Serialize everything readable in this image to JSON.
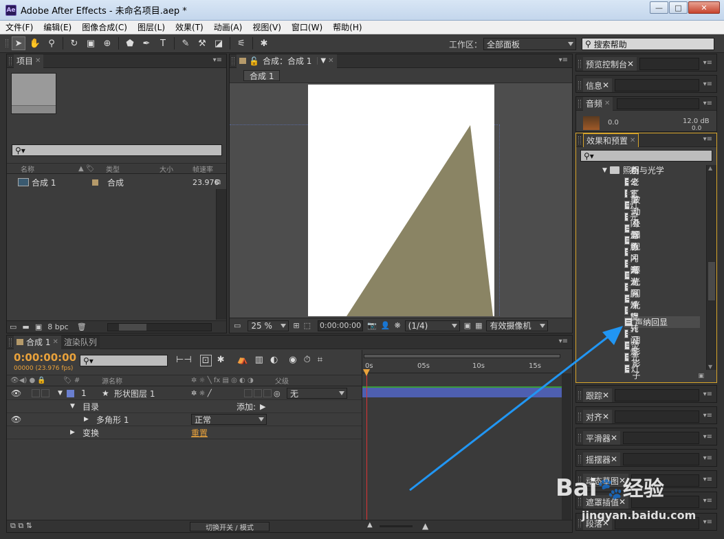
{
  "window": {
    "title": "Adobe After Effects - 未命名项目.aep *",
    "logo": "Ae",
    "buttons": [
      "—",
      "□",
      "✕"
    ]
  },
  "menu": [
    "文件(F)",
    "编辑(E)",
    "图像合成(C)",
    "图层(L)",
    "效果(T)",
    "动画(A)",
    "视图(V)",
    "窗口(W)",
    "帮助(H)"
  ],
  "toolbar": {
    "workspace_label": "工作区：",
    "workspace_value": "全部面板",
    "search_placeholder": "搜索帮助",
    "tools": [
      "selection-tool-icon",
      "hand-tool-icon",
      "zoom-tool-icon",
      "rotate-tool-icon",
      "camera-orbit-icon",
      "pan-behind-icon",
      "shape-tool-icon",
      "pen-tool-icon",
      "text-tool-icon",
      "brush-tool-icon",
      "clone-stamp-icon",
      "eraser-icon",
      "roto-brush-icon",
      "puppet-pin-icon"
    ]
  },
  "project": {
    "tab": "项目",
    "columns": [
      "名称",
      "类型",
      "大小",
      "帧速率"
    ],
    "items": [
      {
        "name": "合成 1",
        "type": "合成",
        "fps": "23.976"
      }
    ],
    "bpc": "8 bpc"
  },
  "comp": {
    "tab": "合成：合成 1",
    "breadcrumb": "合成 1",
    "zoom": "25 %",
    "timecode": "0:00:00:00",
    "resolution": "(1/4)",
    "camera": "有效摄像机",
    "shape_color": "#8a8464"
  },
  "timeline": {
    "tab": "合成 1",
    "render_tab": "渲染队列",
    "timecode": "0:00:00:00",
    "fps_info": "00000 (23.976 fps)",
    "columns": {
      "source": "源名称",
      "parent": "父级"
    },
    "layer": {
      "index": "1",
      "name": "形状图层 1",
      "parent": "无"
    },
    "rows": {
      "contents": "目录",
      "add": "添加:",
      "polygon": "多角形 1",
      "mode": "正常",
      "transform": "变换",
      "reset": "重置"
    },
    "ruler": [
      "0s",
      "05s",
      "10s",
      "15s"
    ],
    "bottom_button": "切换开关 / 模式"
  },
  "right": {
    "preview": "预览控制台",
    "info": "信息",
    "audio": "音频",
    "audio_levels": {
      "left": "0.0",
      "right": "12.0 dB",
      "right2": "0.0"
    },
    "effects": {
      "tab": "效果和预置",
      "folder": "照明与光学",
      "items": [
        "百老汇",
        "办公室灯光",
        "波动",
        "单词闪烁",
        "叠加",
        "浮现",
        "蓝色闪光",
        "脉冲曝光",
        "曝光",
        "汽泡脉冲",
        "闪光",
        "闪烁曝光",
        "声纳回显",
        "旋转闪烁",
        "阴影",
        "荧光灯",
        "影子"
      ],
      "highlight_index": 12
    },
    "collapsed": [
      "跟踪",
      "对齐",
      "平滑器",
      "摇摆器",
      "动态草图",
      "遮罩插值",
      "段落"
    ]
  },
  "watermark": {
    "brand": "Bai",
    "brand2": "经验",
    "url": "jingyan.baidu.com"
  },
  "colors": {
    "accent_orange": "#e9a23b",
    "panel_border_active": "#d9a62a",
    "layer_blue": "#6a7fcf",
    "annotation_arrow": "#2196f3"
  }
}
